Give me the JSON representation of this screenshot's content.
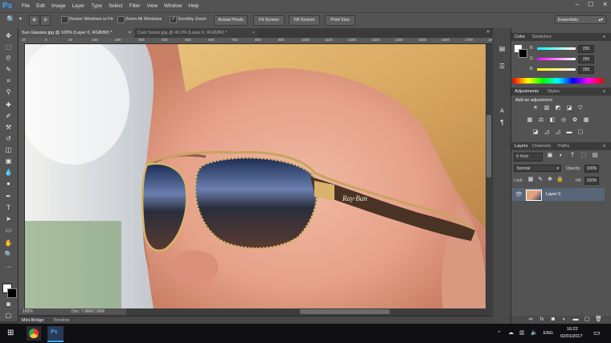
{
  "menubar": {
    "logo": "Ps",
    "items": [
      "File",
      "Edit",
      "Image",
      "Layer",
      "Type",
      "Select",
      "Filter",
      "View",
      "Window",
      "Help"
    ],
    "controls": [
      "–",
      "☐",
      "✕"
    ]
  },
  "options": {
    "zoom_pct_hint": "",
    "resize_windows": "Resize Windows to Fit",
    "zoom_all": "Zoom All Windows",
    "scrubby": "Scrubby Zoom",
    "buttons": [
      "Actual Pixels",
      "Fit Screen",
      "Fill Screen",
      "Print Size"
    ],
    "workspace": "Essentials"
  },
  "tabs": [
    {
      "label": "Sun Glasses.jpg @ 100% (Layer 0, RGB/8#) *",
      "active": true
    },
    {
      "label": "Cool Scene.jpg @ 40.9% (Layer 0, RGB/8#) *",
      "active": false
    }
  ],
  "ruler_h": [
    "30",
    "0",
    "30",
    "100",
    "200",
    "300",
    "400",
    "500",
    "600",
    "700",
    "800",
    "900",
    "1000",
    "1100",
    "1200",
    "1300",
    "1400",
    "1500",
    "1600",
    "1700",
    "1800"
  ],
  "status": {
    "zoom": "100%",
    "doc": "Doc: 7.06M/7.06M"
  },
  "bottom_tabs": [
    "Mini Bridge",
    "Timeline"
  ],
  "color_panel": {
    "tabs": [
      "Color",
      "Swatches"
    ],
    "channels": [
      {
        "label": "R",
        "value": "255"
      },
      {
        "label": "G",
        "value": "255"
      },
      {
        "label": "B",
        "value": "255"
      }
    ]
  },
  "adjustments_panel": {
    "tabs": [
      "Adjustments",
      "Styles"
    ],
    "heading": "Add an adjustment"
  },
  "layers_panel": {
    "tabs": [
      "Layers",
      "Channels",
      "Paths"
    ],
    "kind_label": "Kind",
    "blend_mode": "Normal",
    "opacity_label": "Opacity:",
    "opacity_value": "100%",
    "lock_label": "Lock:",
    "fill_label": "Fill:",
    "fill_value": "100%",
    "layer_name": "Layer 0"
  },
  "taskbar": {
    "lang": "ENG",
    "time": "16:22",
    "date": "02/01/2017"
  },
  "colors": {
    "ui_dark": "#535353",
    "accent": "#31a8ff",
    "selected_layer": "#596678"
  }
}
